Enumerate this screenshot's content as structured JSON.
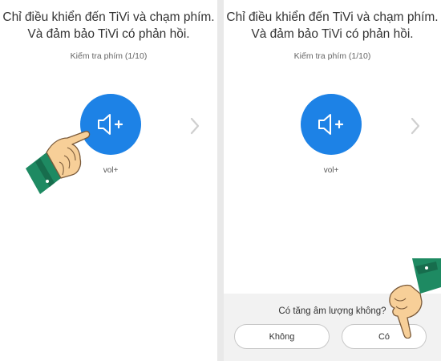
{
  "screens": [
    {
      "instruction_line1": "Chỉ điều khiển đến TiVi và chạm phím.",
      "instruction_line2": "Và đảm bảo TiVi có phản hồi.",
      "check_label": "Kiếm tra phím (1/10)",
      "key_icon": "volume-up-icon",
      "key_label": "vol+",
      "next_icon": "chevron-right-icon"
    },
    {
      "instruction_line1": "Chỉ điều khiển đến TiVi và chạm phím.",
      "instruction_line2": "Và đảm bảo TiVi có phản hồi.",
      "check_label": "Kiếm tra phím (1/10)",
      "key_icon": "volume-up-icon",
      "key_label": "vol+",
      "next_icon": "chevron-right-icon",
      "dialog": {
        "question": "Có tăng âm lượng không?",
        "no_label": "Không",
        "yes_label": "Có"
      }
    }
  ],
  "colors": {
    "accent": "#1d82e6",
    "sleeve": "#1e8a62",
    "skin": "#f7cf98"
  }
}
